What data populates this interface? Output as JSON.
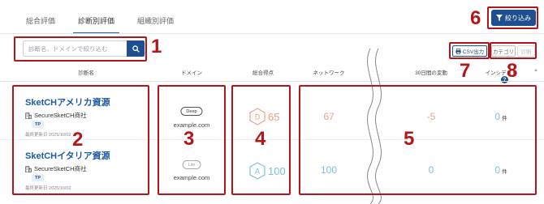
{
  "tabs": [
    {
      "label": "総合評価",
      "active": false
    },
    {
      "label": "診断別評価",
      "active": true
    },
    {
      "label": "組織別評価",
      "active": false
    }
  ],
  "filter_button": {
    "label": "絞り込み",
    "icon": "filter-icon"
  },
  "search": {
    "placeholder": "診断名、ドメインで絞り込む",
    "value": "",
    "icon": "search-icon"
  },
  "actions": {
    "csv_label": "CSV出力",
    "csv_icon": "print-icon",
    "category_label": "カテゴリ",
    "diagnosis_label": "診断"
  },
  "columns": {
    "name": "診断名",
    "domain": "ドメイン",
    "score": "総合得点",
    "network": "ネットワーク",
    "change": "30日間の変動",
    "incident": "インシデント"
  },
  "rows": [
    {
      "name": "SketCHアメリカ資源",
      "company": "SecureSketCH商社",
      "tag": "TP",
      "updated": "最終更新日 2025/10/02",
      "plan": "Deep",
      "domain": "example.com",
      "grade": "D",
      "score": "65",
      "network": "67",
      "change": "-5",
      "incident": "0",
      "incident_unit": "件"
    },
    {
      "name": "SketCHイタリア資源",
      "company": "SecureSketCH商社",
      "tag": "TP",
      "updated": "最終更新日 2025/10/02",
      "plan": "Lite",
      "domain": "example.com",
      "grade": "A",
      "score": "100",
      "network": "100",
      "change": "0",
      "incident": "0",
      "incident_unit": "件"
    }
  ],
  "help_icon": "?",
  "annotations": [
    "1",
    "2",
    "3",
    "4",
    "5",
    "6",
    "7",
    "8"
  ],
  "colors": {
    "accent": "#1f4f8f",
    "link": "#1e5aa8",
    "grade_d": "#f0a08a",
    "grade_a": "#7cc0e6",
    "annotation": "#b3161a"
  }
}
